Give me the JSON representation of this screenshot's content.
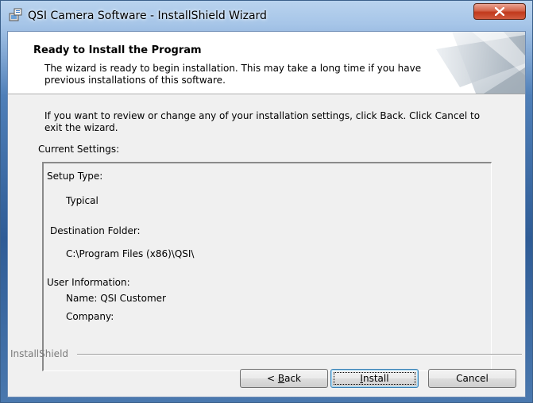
{
  "window": {
    "title": "QSI Camera Software - InstallShield Wizard",
    "icons": {
      "app": "installer-icon",
      "close": "close-icon"
    },
    "colors": {
      "title_bar": "#a6c5e8",
      "close_button": "#c1391c",
      "client_bg": "#f0f0f0"
    }
  },
  "header": {
    "title": "Ready to Install the Program",
    "description_line1": "The wizard is ready to begin installation. This may take a long time if you have",
    "description_line2": "previous installations of this software."
  },
  "body": {
    "instructions_line1": "If you want to review or change any of your installation settings, click Back. Click Cancel to",
    "instructions_line2": "exit the wizard.",
    "current_settings_label": "Current Settings:"
  },
  "settings": {
    "setup_type_label": "Setup Type:",
    "setup_type_value": "Typical",
    "destination_label": "Destination Folder:",
    "destination_value": "C:\\Program Files (x86)\\QSI\\",
    "user_info_label": "User Information:",
    "name_line": "Name: QSI Customer",
    "company_line": "Company:"
  },
  "footer": {
    "brand": "InstallShield",
    "back_prefix": "< ",
    "back_mnemonic": "B",
    "back_rest": "ack",
    "install_mnemonic": "I",
    "install_rest": "nstall",
    "cancel_label": "Cancel"
  }
}
